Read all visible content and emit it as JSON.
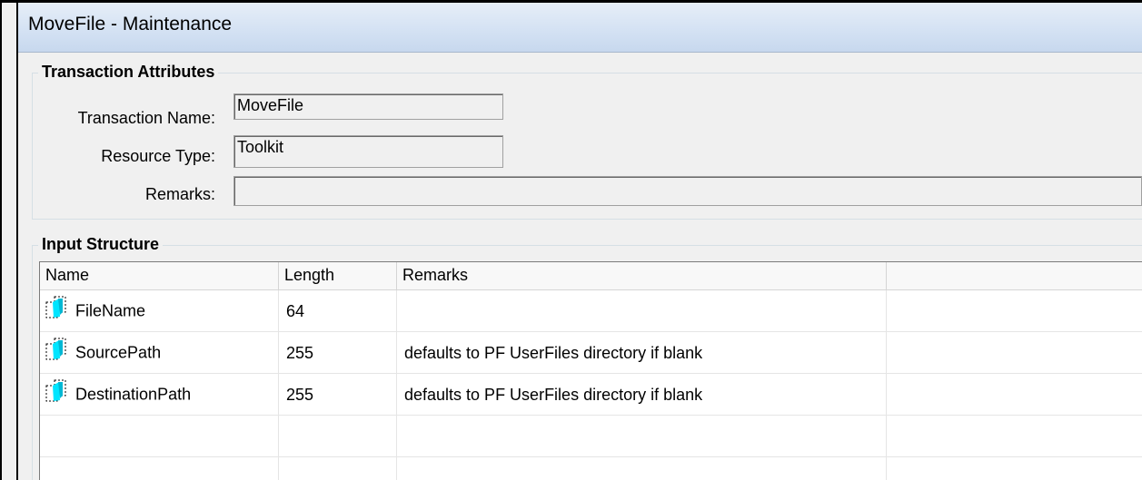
{
  "window": {
    "title": "MoveFile - Maintenance"
  },
  "transaction_attributes": {
    "legend": "Transaction Attributes",
    "name_label": "Transaction Name:",
    "name_value": "MoveFile",
    "resource_label": "Resource Type:",
    "resource_value": "Toolkit",
    "remarks_label": "Remarks:",
    "remarks_value": ""
  },
  "input_structure": {
    "legend": "Input Structure",
    "columns": [
      "Name",
      "Length",
      "Remarks",
      ""
    ],
    "rows": [
      {
        "icon": "field-icon",
        "name": "FileName",
        "length": "64",
        "remarks": ""
      },
      {
        "icon": "field-icon",
        "name": "SourcePath",
        "length": "255",
        "remarks": "defaults to PF UserFiles directory if blank"
      },
      {
        "icon": "field-icon",
        "name": "DestinationPath",
        "length": "255",
        "remarks": "defaults to PF UserFiles directory if blank"
      }
    ]
  },
  "colors": {
    "title_gradient_top": "#e6eef8",
    "title_gradient_bottom": "#c7d8ee",
    "icon_accent": "#00e5ff"
  }
}
